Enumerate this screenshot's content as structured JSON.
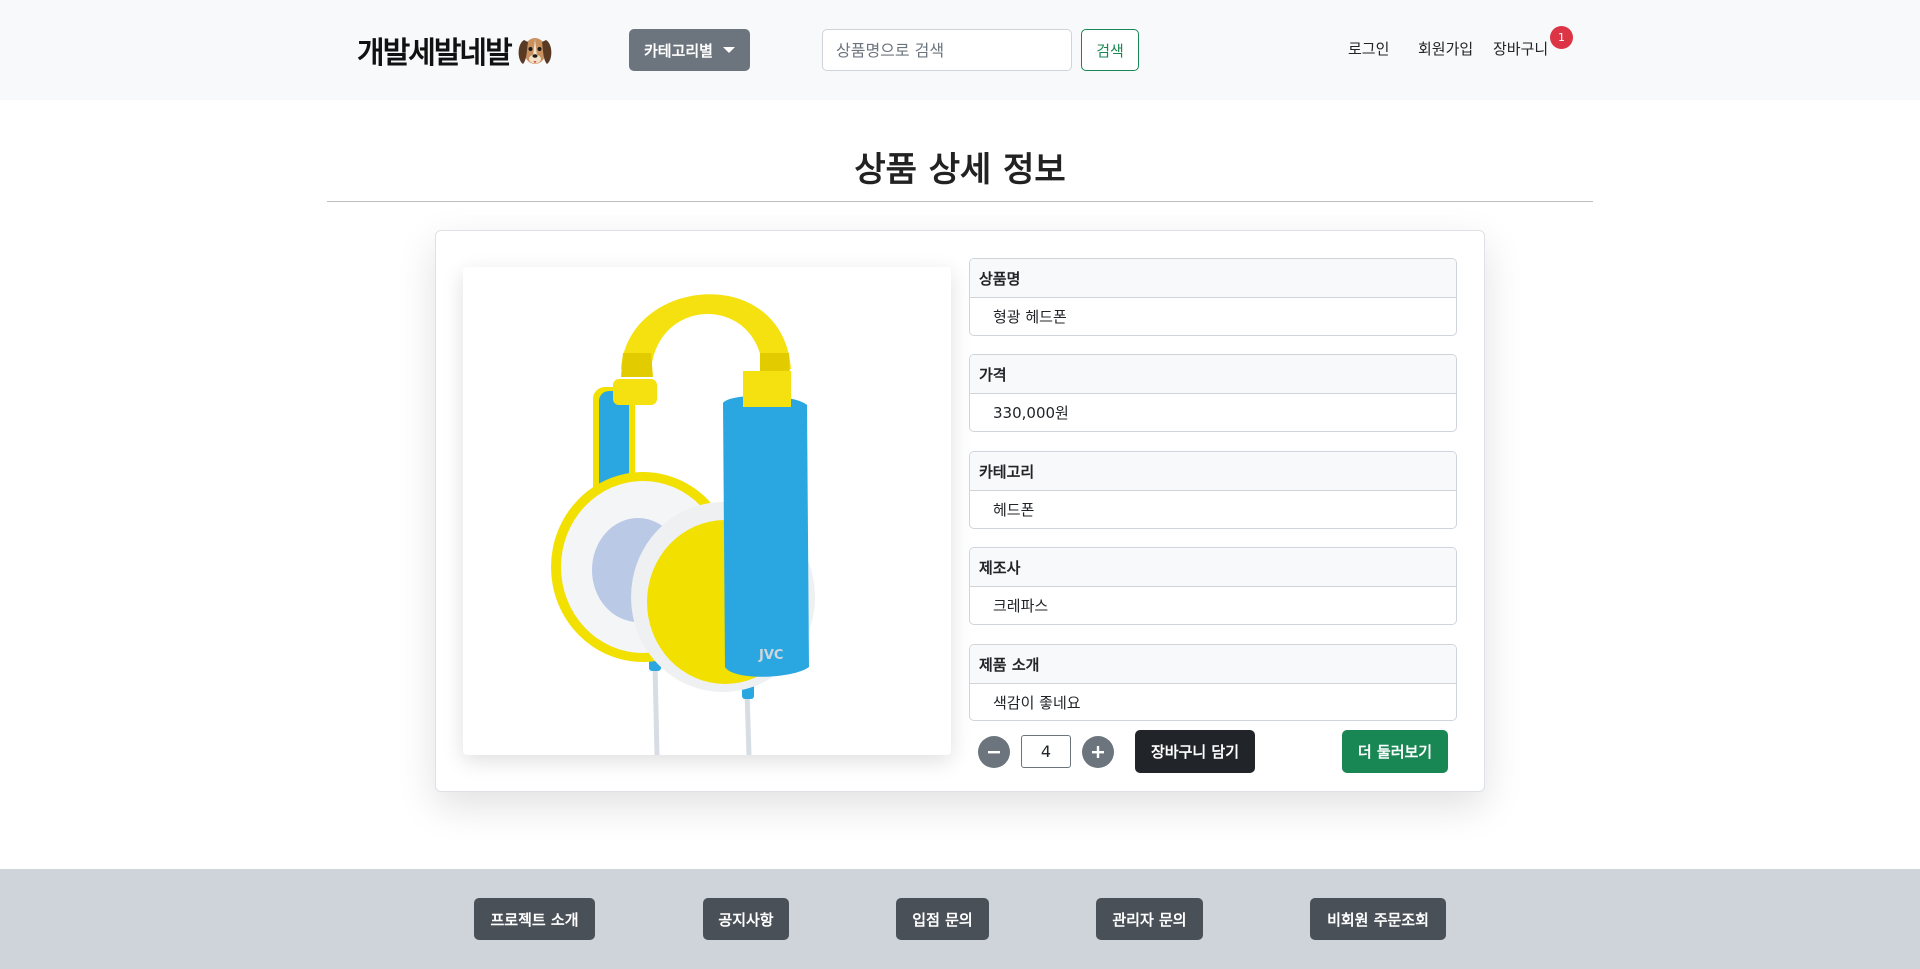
{
  "header": {
    "logo_text": "개발세발네발",
    "category_button": "카테고리별",
    "search": {
      "placeholder": "상품명으로 검색",
      "value": ""
    },
    "search_button": "검색",
    "nav": {
      "login": "로그인",
      "signup": "회원가입",
      "cart": "장바구니",
      "cart_count": "1"
    },
    "colors": {
      "background": "#f8f9fa",
      "category_button": "#6c757d",
      "search_accent": "#198754",
      "badge": "#dc3545"
    }
  },
  "page": {
    "title": "상품 상세 정보"
  },
  "product": {
    "image_icon": "headphones-image",
    "image_brand_text": "JVC",
    "fields": [
      {
        "label": "상품명",
        "value": "형광 헤드폰"
      },
      {
        "label": "가격",
        "value": "330,000원"
      },
      {
        "label": "카테고리",
        "value": "헤드폰"
      },
      {
        "label": "제조사",
        "value": "크레파스"
      },
      {
        "label": "제품 소개",
        "value": "색감이 좋네요"
      }
    ],
    "quantity": "4",
    "minus_icon": "minus-icon",
    "plus_icon": "plus-icon",
    "add_to_cart_button": "장바구니 담기",
    "more_button": "더 둘러보기",
    "colors": {
      "add_to_cart": "#212529",
      "more": "#198754",
      "stepper": "#6c757d"
    }
  },
  "footer": {
    "buttons": [
      "프로젝트 소개",
      "공지사항",
      "입점 문의",
      "관리자 문의",
      "비회원 주문조회"
    ],
    "colors": {
      "background": "#ced4da",
      "button": "#495057"
    }
  }
}
